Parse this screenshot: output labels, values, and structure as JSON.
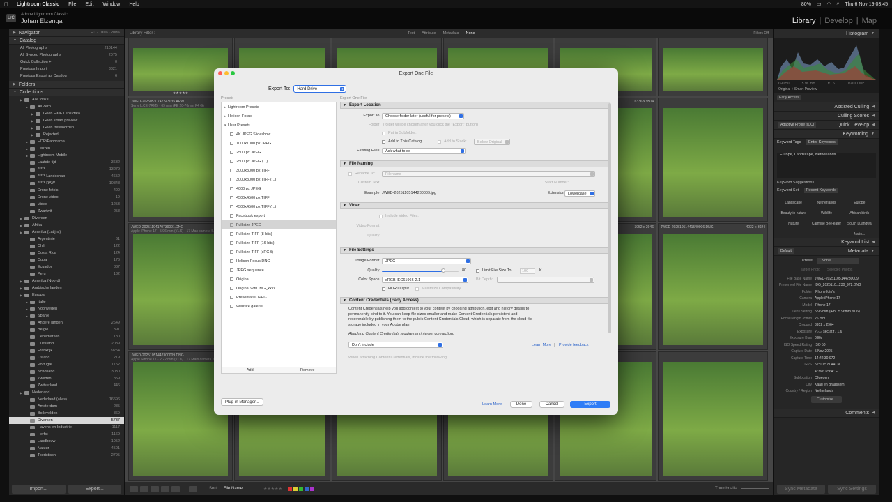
{
  "menubar": {
    "app": "Lightroom Classic",
    "items": [
      "File",
      "Edit",
      "Window",
      "Help"
    ],
    "status_percent": "80%",
    "datetime": "Thu 6 Nov  19:03:45"
  },
  "identity": {
    "logo": "LrC",
    "app_name": "Adobe Lightroom Classic",
    "user": "Johan Elzenga"
  },
  "modules": {
    "library": "Library",
    "develop": "Develop",
    "map": "Map",
    "sep": "|"
  },
  "left_panel": {
    "navigator": {
      "title": "Navigator",
      "options": "FIT  ·  100%  ·  200%"
    },
    "catalog": {
      "title": "Catalog",
      "items": [
        {
          "label": "All Photographs",
          "count": "210144"
        },
        {
          "label": "All Synced Photographs",
          "count": "2075"
        },
        {
          "label": "Quick Collection +",
          "count": "0"
        },
        {
          "label": "Previous Import",
          "count": "3821"
        },
        {
          "label": "Previous Export as Catalog",
          "count": "6"
        }
      ]
    },
    "folders": {
      "title": "Folders"
    },
    "collections": {
      "title": "Collections",
      "items": [
        {
          "label": "Alle foto's",
          "count": "",
          "indent": 1
        },
        {
          "label": "All Zero",
          "count": "",
          "indent": 2
        },
        {
          "label": "Geen EXIF Lens data",
          "count": "",
          "indent": 3
        },
        {
          "label": "Geen smart preview",
          "count": "",
          "indent": 3
        },
        {
          "label": "Geen trefwoorden",
          "count": "",
          "indent": 3
        },
        {
          "label": "Rejected",
          "count": "",
          "indent": 3
        },
        {
          "label": "HDR/Panorama",
          "count": "",
          "indent": 2
        },
        {
          "label": "Lenzen",
          "count": "",
          "indent": 2
        },
        {
          "label": "Lightroom Mobile",
          "count": "",
          "indent": 2
        },
        {
          "label": "Laatste tijd",
          "count": "3632",
          "indent": 2
        },
        {
          "label": "*****",
          "count": "13279",
          "indent": 2
        },
        {
          "label": "***** Landschap",
          "count": "4652",
          "indent": 2
        },
        {
          "label": "***** RAW",
          "count": "10848",
          "indent": 2
        },
        {
          "label": "Drone foto's",
          "count": "400",
          "indent": 2
        },
        {
          "label": "Drone video",
          "count": "19",
          "indent": 2
        },
        {
          "label": "Video",
          "count": "1253",
          "indent": 2
        },
        {
          "label": "Zwartwit",
          "count": "258",
          "indent": 2
        },
        {
          "label": "Diversen",
          "count": "",
          "indent": 1
        },
        {
          "label": "Afrika",
          "count": "",
          "indent": 1
        },
        {
          "label": "Amerika (Latijns)",
          "count": "",
          "indent": 1
        },
        {
          "label": "Argentinie",
          "count": "61",
          "indent": 2
        },
        {
          "label": "Chili",
          "count": "122",
          "indent": 2
        },
        {
          "label": "Costa Rica",
          "count": "124",
          "indent": 2
        },
        {
          "label": "Cuba",
          "count": "176",
          "indent": 2
        },
        {
          "label": "Ecuador",
          "count": "837",
          "indent": 2
        },
        {
          "label": "Peru",
          "count": "132",
          "indent": 2
        },
        {
          "label": "Amerika (Noord)",
          "count": "",
          "indent": 1
        },
        {
          "label": "Arabische landen",
          "count": "",
          "indent": 1
        },
        {
          "label": "Europa",
          "count": "",
          "indent": 1
        },
        {
          "label": "Italie",
          "count": "",
          "indent": 2
        },
        {
          "label": "Noorwegen",
          "count": "",
          "indent": 2
        },
        {
          "label": "Spanje",
          "count": "",
          "indent": 2
        },
        {
          "label": "Andere landen",
          "count": "2649",
          "indent": 2
        },
        {
          "label": "Belgie",
          "count": "391",
          "indent": 2
        },
        {
          "label": "Denemarken",
          "count": "180",
          "indent": 2
        },
        {
          "label": "Duitsland",
          "count": "2089",
          "indent": 2
        },
        {
          "label": "Frankrijk",
          "count": "9254",
          "indent": 2
        },
        {
          "label": "IJsland",
          "count": "219",
          "indent": 2
        },
        {
          "label": "Portugal",
          "count": "1752",
          "indent": 2
        },
        {
          "label": "Schotland",
          "count": "3030",
          "indent": 2
        },
        {
          "label": "Zweden",
          "count": "859",
          "indent": 2
        },
        {
          "label": "Zwitserland",
          "count": "446",
          "indent": 2
        },
        {
          "label": "Nederland",
          "count": "",
          "indent": 1
        },
        {
          "label": "Nederland (alles)",
          "count": "16696",
          "indent": 2
        },
        {
          "label": "Amsterdam",
          "count": "285",
          "indent": 2
        },
        {
          "label": "Bollevelden",
          "count": "869",
          "indent": 2
        },
        {
          "label": "Diversen",
          "count": "5737",
          "indent": 2,
          "selected": true
        },
        {
          "label": "Havens en Industrie",
          "count": "1117",
          "indent": 2
        },
        {
          "label": "Herfst",
          "count": "1169",
          "indent": 2
        },
        {
          "label": "Landbouw",
          "count": "1052",
          "indent": 2
        },
        {
          "label": "Natuur",
          "count": "4501",
          "indent": 2
        },
        {
          "label": "Toeristisch",
          "count": "2795",
          "indent": 2
        }
      ]
    },
    "import_button": "Import...",
    "export_button": "Export..."
  },
  "grid": {
    "filter_label": "Library Filter :",
    "filter_options": [
      "Text",
      "Attribute",
      "Metadata",
      "None"
    ],
    "filters_off": "Filters Off",
    "cells": [
      {
        "name": "JWED-20250530747243035.ARW",
        "info": "Sony ILCE-7RM5 · 69 mm (FE 20-70mm F4 G)",
        "dims": ""
      },
      {
        "name": "",
        "info": "",
        "dims": ""
      },
      {
        "name": "",
        "info": "",
        "dims": ""
      },
      {
        "name": "",
        "info": "",
        "dims": "9504 x 6336"
      },
      {
        "name": "JWED-20250531847463040.ARW",
        "info": "",
        "dims": "6336 x 9504"
      },
      {
        "name": "JWED-20251104170739001.DNG",
        "info": "Apple iPhone 17 · 5.96 mm (f/1.6) · 17 Max camera 5.96",
        "dims": ""
      },
      {
        "name": "",
        "info": "",
        "dims": "3952 x 2946"
      },
      {
        "name": "JWED-20251051441540006.DNG",
        "info": "",
        "dims": "4032 x 3024"
      },
      {
        "name": "JWED-20251051442300009.DNG",
        "info": "Apple iPhone 17 · 2.22 mm (f/1.6) · 17 Main camera 2.22",
        "dims": ""
      }
    ],
    "rating": "★★★★★",
    "sort_label": "Sort:",
    "sort_value": "File Name",
    "thumbnails_label": "Thumbnails"
  },
  "right_panel": {
    "histogram": {
      "title": "Histogram",
      "iso": "ISO 50",
      "focal": "5.96 mm",
      "aperture": "f/1.6",
      "shutter": "1/2000 sec",
      "preview": "Original + Smart Preview"
    },
    "early_access": "Early Access",
    "panels": [
      "Assisted Culling",
      "Culling Scores",
      "Quick Develop",
      "Keywording"
    ],
    "quick_develop_value": "Adaptive Profile (ICC)",
    "keyword_tags_label": "Keyword Tags",
    "keyword_tags_value": "Enter Keywords",
    "keywords": "Europe, Landscape, Netherlands",
    "keyword_suggestions": "Keyword Suggestions",
    "keyword_set_label": "Keyword Set",
    "keyword_set_value": "Recent Keywords",
    "keyword_grid": [
      "Landscape",
      "Netherlands",
      "Europe",
      "Beauty in nature",
      "Wildlife",
      "African birds",
      "Nature",
      "Carmine Bee-eater",
      "South Luangwa Natio..."
    ],
    "keyword_list": "Keyword List",
    "metadata_title": "Metadata",
    "metadata_default": "Default",
    "preset_label": "Preset",
    "preset_value": "None",
    "target_photo": "Target Photo",
    "selected_photos": "Selected Photos",
    "meta": [
      {
        "k": "File Base Name",
        "v": "JWED-20251105144230009"
      },
      {
        "k": "Preserved File Name",
        "v": "IDG_2025110...230_972.DNG"
      },
      {
        "k": "Folder",
        "v": "iPhone foto's"
      },
      {
        "k": "Camera",
        "v": "Apple iPhone 17"
      },
      {
        "k": "Model",
        "v": "iPhone 17"
      },
      {
        "k": "Lens Setting",
        "v": "5.96 mm (iPh...5.96mm f/1.6)"
      },
      {
        "k": "Focal Length 35mm",
        "v": "26 mm"
      },
      {
        "k": "Cropped",
        "v": "3952 x 2964"
      },
      {
        "k": "Exposure",
        "v": "¹⁄₃₀₀₀ sec at f / 1.6"
      },
      {
        "k": "Exposure Bias",
        "v": "0 EV"
      },
      {
        "k": "ISO Speed Rating",
        "v": "ISO 50"
      },
      {
        "k": "Capture Date",
        "v": "5 Nov 2025"
      },
      {
        "k": "Capture Time",
        "v": "14:42:30.972"
      },
      {
        "k": "GPS",
        "v": "52°10'5.8044\" N"
      },
      {
        "k": "",
        "v": "4°36'6.6564\" E"
      },
      {
        "k": "Sublocation",
        "v": "Ofwegen"
      },
      {
        "k": "City",
        "v": "Kaag en Braassem"
      },
      {
        "k": "Country / Region",
        "v": "Netherlands"
      }
    ],
    "customize": "Customize...",
    "comments": "Comments",
    "sync_metadata": "Sync Metadata",
    "sync_settings": "Sync Settings"
  },
  "dialog": {
    "title": "Export One File",
    "export_to_label": "Export To:",
    "export_to_value": "Hard Drive",
    "preset_label": "Preset:",
    "export_one_label": "Export One File",
    "presets": [
      {
        "label": "Lightroom Presets",
        "group": true
      },
      {
        "label": "Helicon Focus",
        "group": true
      },
      {
        "label": "User Presets",
        "group": true,
        "open": true
      },
      {
        "label": "4K JPEG Slideshow"
      },
      {
        "label": "1000x1000 px JPEG"
      },
      {
        "label": "2500 px JPEG"
      },
      {
        "label": "2500 px JPEG (...)"
      },
      {
        "label": "3000x3000 px TIFF"
      },
      {
        "label": "3000x3000 px TIFF (...)"
      },
      {
        "label": "4000 px JPEG"
      },
      {
        "label": "4500x4500 px TIFF"
      },
      {
        "label": "4500x4500 px TIFF (...)"
      },
      {
        "label": "Facebook export"
      },
      {
        "label": "Full size JPEG",
        "selected": true
      },
      {
        "label": "Full size TIFF (8 bits)"
      },
      {
        "label": "Full size TIFF (16 bits)"
      },
      {
        "label": "Full size TIFF (sRGB)"
      },
      {
        "label": "Helicon Focus DNG"
      },
      {
        "label": "JPEG sequence"
      },
      {
        "label": "Original"
      },
      {
        "label": "Original with IMG_xxxx"
      },
      {
        "label": "Presentatie JPEG"
      },
      {
        "label": "Website galerie"
      }
    ],
    "add_button": "Add",
    "remove_button": "Remove",
    "sections": {
      "export_location": "Export Location",
      "file_naming": "File Naming",
      "video": "Video",
      "file_settings": "File Settings",
      "content_credentials": "Content Credentials (Early Access)"
    },
    "location": {
      "export_to_label": "Export To:",
      "export_to_value": "Choose folder later (useful for presets)",
      "folder_label": "Folder:",
      "folder_value": "(folder will be chosen after you click the \"Export\" button)",
      "subfolder": "Put in Subfolder:",
      "add_catalog": "Add to This Catalog",
      "add_stack": "Add to Stack:",
      "below_original": "Below Original",
      "existing_label": "Existing Files:",
      "existing_value": "Ask what to do"
    },
    "naming": {
      "rename_label": "Rename To:",
      "rename_value": "Filename",
      "custom_text": "Custom Text:",
      "start_number": "Start Number:",
      "example_label": "Example:",
      "example_value": "JWED-20251105144230009.jpg",
      "extensions_label": "Extensions:",
      "extensions_value": "Lowercase"
    },
    "video": {
      "include": "Include Video Files:",
      "format": "Video Format:",
      "quality": "Quality:"
    },
    "filesettings": {
      "format_label": "Image Format:",
      "format_value": "JPEG",
      "quality_label": "Quality:",
      "quality_value": "80",
      "quality_fraction": 0.8,
      "limit_label": "Limit File Size To:",
      "limit_value": "100",
      "limit_unit": "K",
      "colorspace_label": "Color Space:",
      "colorspace_value": "sRGB IEC61966-2.1",
      "bitdepth_label": "Bit Depth:",
      "hdr_label": "HDR Output",
      "max_compat": "Maximize Compatibility"
    },
    "credentials": {
      "text": "Content Credentials help you add context to your content by choosing attribution, edit and history details to permanently bind to it. You can keep file sizes smaller and make Content Credentials persistent and recoverable by publishing them to the public Content Credentials Cloud, which is separate from the cloud file storage included in your Adobe plan.",
      "note": "Attaching Content Credentials requires an internet connection.",
      "include_value": "Don't include",
      "learn_more": "Learn More",
      "sep": "|",
      "feedback": "Provide feedback",
      "when": "When attaching Content Credentials, include the following:"
    },
    "plugin_manager": "Plug-in Manager...",
    "learn_more": "Learn More",
    "done": "Done",
    "cancel": "Cancel",
    "export": "Export"
  }
}
